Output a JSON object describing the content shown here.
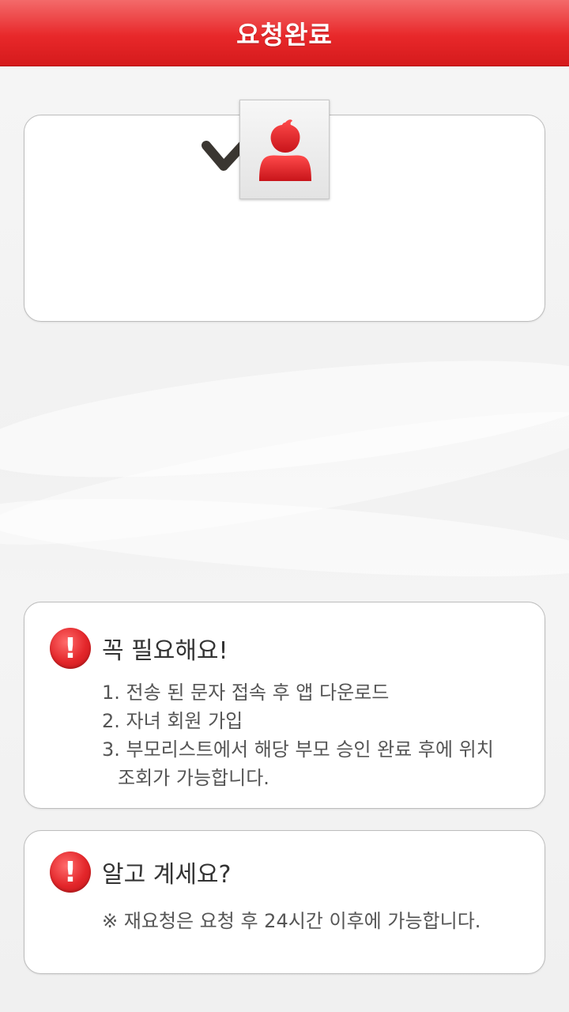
{
  "header": {
    "title": "요청완료"
  },
  "status": {
    "check_icon": "check-icon",
    "avatar_icon": "person-icon"
  },
  "notice_required": {
    "icon": "alert-icon",
    "title": "꼭 필요해요!",
    "items": [
      "1. 전송 된 문자 접속 후 앱 다운로드",
      "2. 자녀 회원 가입",
      "3. 부모리스트에서 해당 부모 승인 완료 후에 위치",
      "조회가 가능합니다."
    ]
  },
  "notice_info": {
    "icon": "alert-icon",
    "title": "알고 계세요?",
    "text": "※ 재요청은 요청 후 24시간 이후에 가능합니다."
  },
  "colors": {
    "brand": "#e8282a",
    "panel_border": "#bdbdbd",
    "background": "#f3f3f3"
  }
}
